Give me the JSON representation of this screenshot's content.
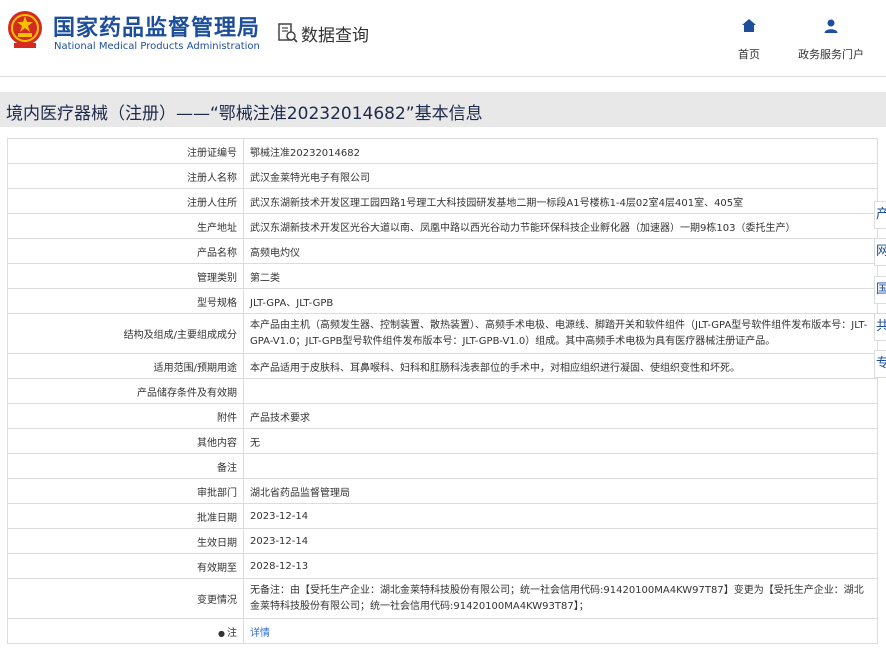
{
  "header": {
    "logo_cn": "国家药品监督管理局",
    "logo_en": "National Medical Products Administration",
    "query_label": "数据查询",
    "nav": [
      {
        "label": "首页",
        "icon": "home-icon"
      },
      {
        "label": "政务服务门户",
        "icon": "user-icon"
      }
    ]
  },
  "banner": {
    "title": "境内医疗器械（注册）——“鄂械注准20232014682”基本信息"
  },
  "table": {
    "rows": [
      {
        "label": "注册证编号",
        "value": "鄂械注准20232014682"
      },
      {
        "label": "注册人名称",
        "value": "武汉金莱特光电子有限公司"
      },
      {
        "label": "注册人住所",
        "value": "武汉东湖新技术开发区理工园四路1号理工大科技园研发基地二期一标段A1号楼栋1-4层02室4层401室、405室"
      },
      {
        "label": "生产地址",
        "value": "武汉东湖新技术开发区光谷大道以南、凤凰中路以西光谷动力节能环保科技企业孵化器（加速器）一期9栋103（委托生产）"
      },
      {
        "label": "产品名称",
        "value": "高频电灼仪"
      },
      {
        "label": "管理类别",
        "value": "第二类"
      },
      {
        "label": "型号规格",
        "value": "JLT-GPA、JLT-GPB"
      },
      {
        "label": "结构及组成/主要组成成分",
        "value": "本产品由主机（高频发生器、控制装置、散热装置）、高频手术电极、电源线、脚踏开关和软件组件（JLT-GPA型号软件组件发布版本号：JLT-GPA-V1.0；JLT-GPB型号软件组件发布版本号：JLT-GPB-V1.0）组成。其中高频手术电极为具有医疗器械注册证产品。"
      },
      {
        "label": "适用范围/预期用途",
        "value": "本产品适用于皮肤科、耳鼻喉科、妇科和肛肠科浅表部位的手术中，对相应组织进行凝固、使组织变性和坏死。"
      },
      {
        "label": "产品储存条件及有效期",
        "value": ""
      },
      {
        "label": "附件",
        "value": "产品技术要求"
      },
      {
        "label": "其他内容",
        "value": "无"
      },
      {
        "label": "备注",
        "value": ""
      },
      {
        "label": "审批部门",
        "value": "湖北省药品监督管理局"
      },
      {
        "label": "批准日期",
        "value": "2023-12-14"
      },
      {
        "label": "生效日期",
        "value": "2023-12-14"
      },
      {
        "label": "有效期至",
        "value": "2028-12-13"
      },
      {
        "label": "变更情况",
        "value": "无备注：由【受托生产企业：湖北金莱特科技股份有限公司；统一社会信用代码:91420100MA4KW97T87】变更为【受托生产企业：湖北金莱特科技股份有限公司；统一社会信用代码:91420100MA4KW93T87】；"
      },
      {
        "label": "注",
        "value": "详情"
      }
    ]
  },
  "side_tabs": [
    "产",
    "网",
    "国",
    "共",
    "专"
  ],
  "colors": {
    "brand": "#1d4e9c",
    "link": "#2a6fd6",
    "banner_bg": "#e8e8e8",
    "border": "#dcdcdc"
  }
}
